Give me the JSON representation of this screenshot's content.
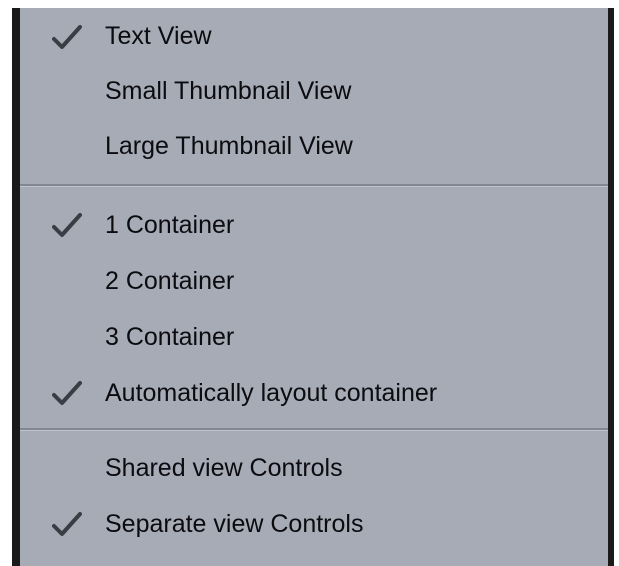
{
  "menu": {
    "sections": [
      {
        "items": [
          {
            "label": "Text View",
            "checked": true
          },
          {
            "label": "Small Thumbnail View",
            "checked": false
          },
          {
            "label": "Large Thumbnail View",
            "checked": false
          }
        ]
      },
      {
        "items": [
          {
            "label": "1 Container",
            "checked": true
          },
          {
            "label": "2 Container",
            "checked": false
          },
          {
            "label": "3 Container",
            "checked": false
          },
          {
            "label": "Automatically layout container",
            "checked": true
          }
        ]
      },
      {
        "items": [
          {
            "label": "Shared view Controls",
            "checked": false
          },
          {
            "label": "Separate view Controls",
            "checked": true
          }
        ]
      }
    ]
  },
  "colors": {
    "menu_background": "#a6abb6",
    "text": "#0b0b10",
    "separator": "#828791",
    "checkmark": "#3a3d44"
  },
  "icons": {
    "check": "checkmark-icon"
  }
}
